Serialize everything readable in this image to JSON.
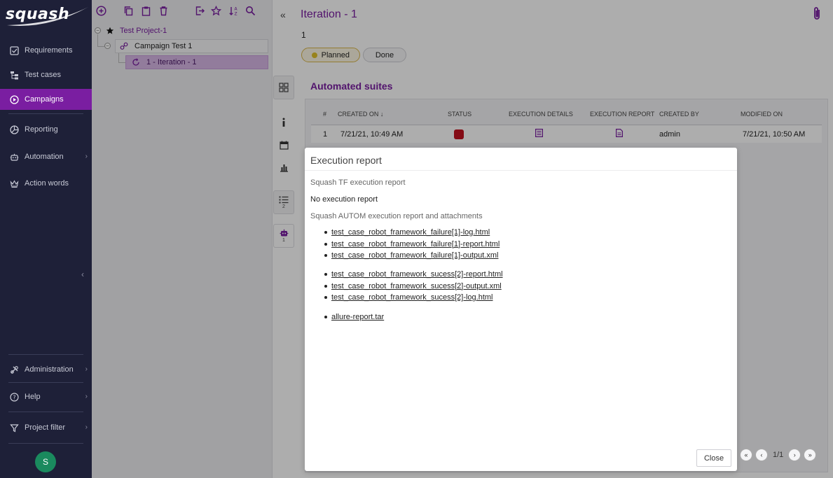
{
  "app": {
    "brand": "squash"
  },
  "sidebar": {
    "items": [
      {
        "label": "Requirements",
        "icon": "checkbox-icon"
      },
      {
        "label": "Test cases",
        "icon": "test-cases-icon"
      },
      {
        "label": "Campaigns",
        "icon": "play-circle-icon"
      },
      {
        "label": "Reporting",
        "icon": "pie-chart-icon"
      },
      {
        "label": "Automation",
        "icon": "robot-icon"
      },
      {
        "label": "Action words",
        "icon": "crown-icon"
      }
    ],
    "bottom_items": [
      {
        "label": "Administration",
        "icon": "tools-icon"
      },
      {
        "label": "Help",
        "icon": "help-icon"
      },
      {
        "label": "Project filter",
        "icon": "filter-icon"
      }
    ],
    "avatar_initial": "S",
    "active_color": "#7a1ea1"
  },
  "tree": {
    "project": "Test Project-1",
    "campaign": "Campaign Test 1",
    "iteration": "1 - Iteration - 1"
  },
  "main": {
    "title": "Iteration - 1",
    "reference": "1",
    "status_planned": "Planned",
    "status_done": "Done",
    "rail_counts": {
      "test_plan": "2",
      "automated": "1"
    },
    "section_title": "Automated suites",
    "table": {
      "headers": [
        "#",
        "CREATED ON",
        "STATUS",
        "EXECUTION DETAILS",
        "EXECUTION REPORT",
        "CREATED BY",
        "MODIFIED ON"
      ],
      "rows": [
        {
          "index": "1",
          "created_on": "7/21/21, 10:49 AM",
          "status_color": "#c3111f",
          "created_by": "admin",
          "modified_on": "7/21/21, 10:50 AM"
        }
      ]
    },
    "pager": {
      "text": "1/1"
    }
  },
  "modal": {
    "title": "Execution report",
    "tf_label": "Squash TF execution report",
    "tf_value": "No execution report",
    "autom_label": "Squash AUTOM execution report and attachments",
    "group1": [
      "test_case_robot_framework_failure[1]-log.html",
      "test_case_robot_framework_failure[1]-report.html",
      "test_case_robot_framework_failure[1]-output.xml"
    ],
    "group2": [
      "test_case_robot_framework_sucess[2]-report.html",
      "test_case_robot_framework_sucess[2]-output.xml",
      "test_case_robot_framework_sucess[2]-log.html"
    ],
    "group3": [
      "allure-report.tar"
    ],
    "close_label": "Close"
  }
}
